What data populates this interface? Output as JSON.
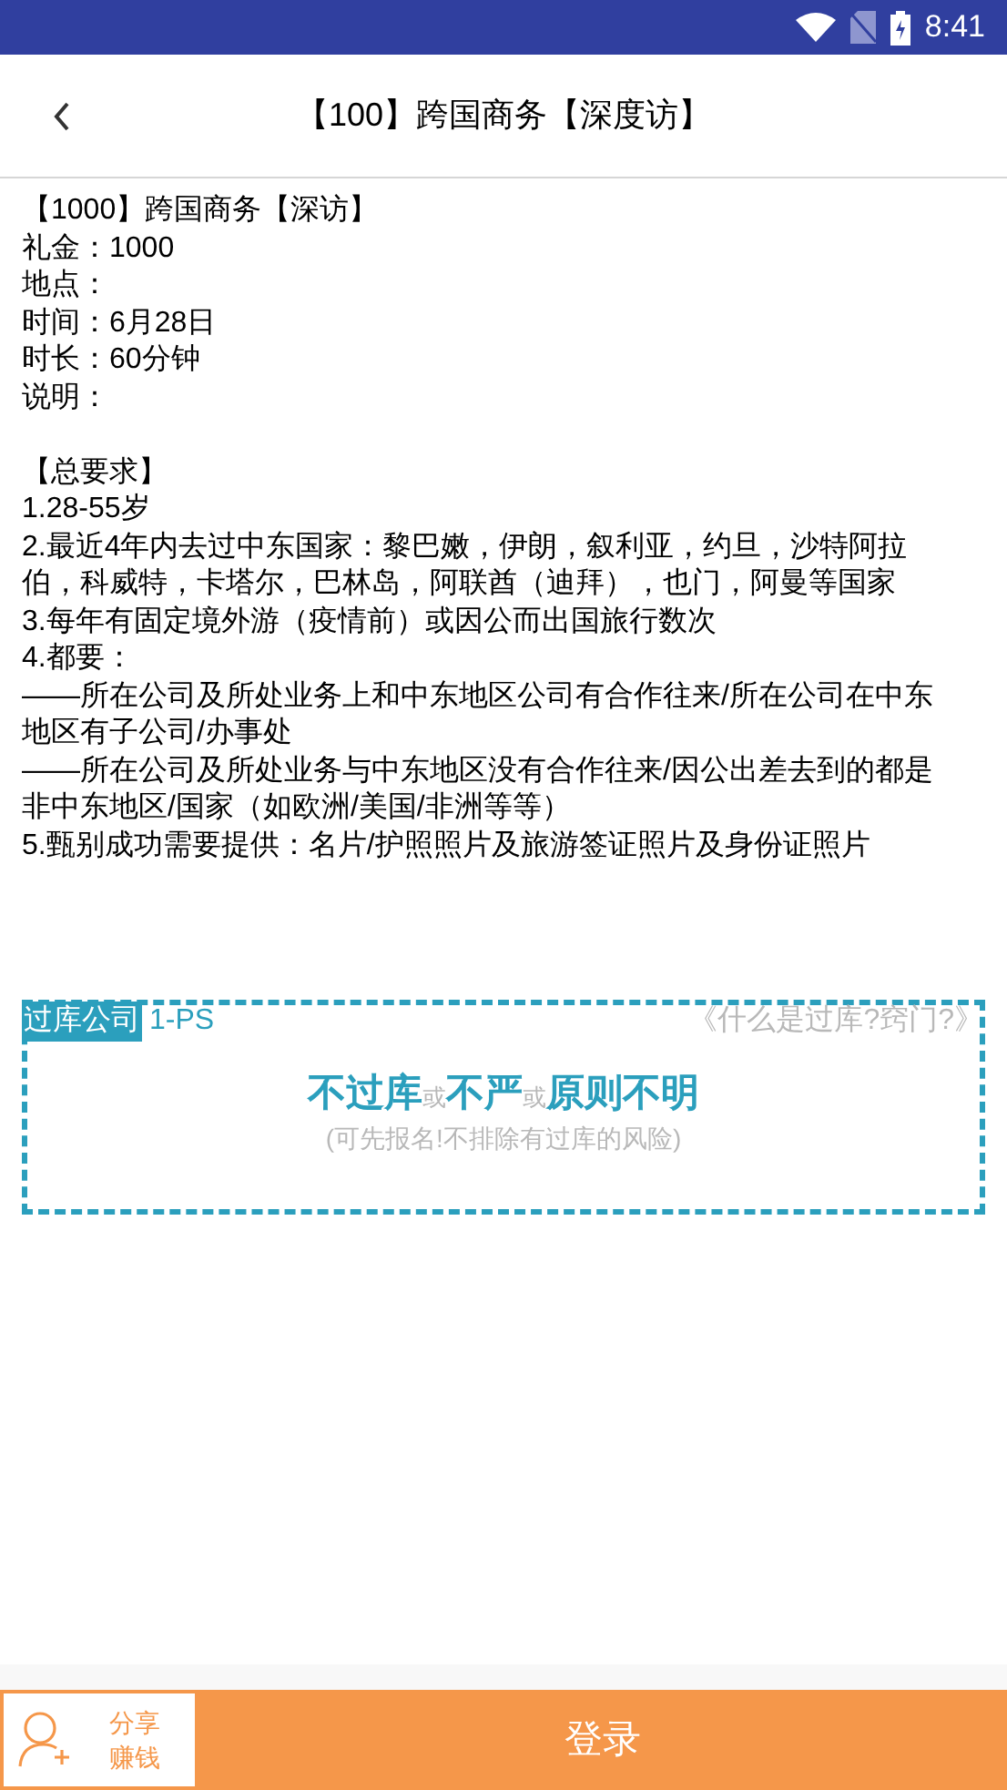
{
  "status_bar": {
    "time": "8:41"
  },
  "header": {
    "title": "【100】跨国商务【深度访】"
  },
  "details": [
    "【1000】跨国商务【深访】",
    "礼金：1000",
    "地点：",
    "时间：6月28日",
    "时长：60分钟",
    "说明："
  ],
  "requirements": [
    "【总要求】",
    "1.28-55岁",
    "2.最近4年内去过中东国家：黎巴嫩，伊朗，叙利亚，约旦，沙特阿拉伯，科威特，卡塔尔，巴林岛，阿联酋（迪拜），也门，阿曼等国家",
    "3.每年有固定境外游（疫情前）或因公而出国旅行数次",
    "4.都要：",
    "——所在公司及所处业务上和中东地区公司有合作往来/所在公司在中东地区有子公司/办事处",
    "——所在公司及所处业务与中东地区没有合作往来/因公出差去到的都是非中东地区/国家（如欧洲/美国/非洲等等）",
    "5.甄别成功需要提供：名片/护照照片及旅游签证照片及身份证照片"
  ],
  "company_box": {
    "tag": "过库公司",
    "code": "1-PS",
    "link": "《什么是过库?窍门?》",
    "verdict": [
      {
        "text": "不过库",
        "kind": "main"
      },
      {
        "text": "或",
        "kind": "sep"
      },
      {
        "text": "不严",
        "kind": "main"
      },
      {
        "text": "或",
        "kind": "sep"
      },
      {
        "text": "原则不明",
        "kind": "main"
      }
    ],
    "note": "(可先报名!不排除有过库的风险)"
  },
  "bottom_bar": {
    "share": [
      "分享",
      "赚钱"
    ],
    "login": "登录"
  }
}
